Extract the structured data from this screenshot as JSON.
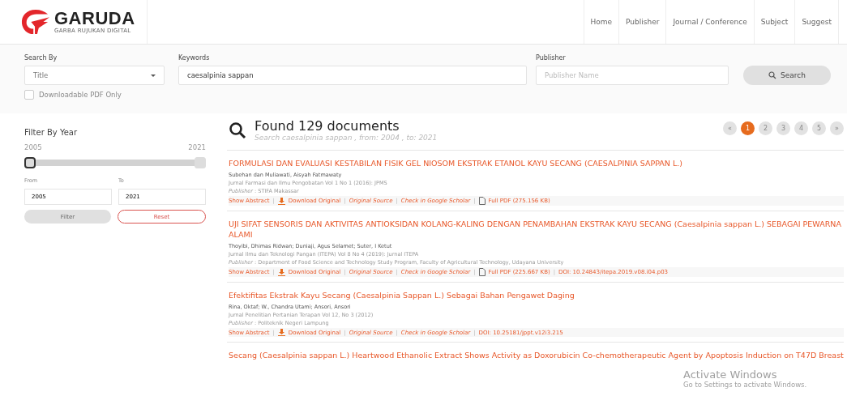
{
  "logo": {
    "name": "GARUDA",
    "tagline": "GARBA RUJUKAN DIGITAL"
  },
  "nav": [
    "Home",
    "Publisher",
    "Journal / Conference",
    "Subject",
    "Suggest"
  ],
  "search": {
    "search_by": {
      "label": "Search By",
      "value": "Title"
    },
    "keywords": {
      "label": "Keywords",
      "value": "caesalpinia sappan"
    },
    "publisher": {
      "label": "Publisher",
      "placeholder": "Publisher Name"
    },
    "button": "Search",
    "pdf_only": {
      "label": "Downloadable PDF Only",
      "checked": false
    }
  },
  "filter": {
    "title": "Filter By Year",
    "min_label": "2005",
    "max_label": "2021",
    "thumbs": [
      {
        "level": 0,
        "selected": true
      },
      {
        "level": 1,
        "selected": false
      }
    ],
    "from": {
      "label": "From",
      "value": "2005"
    },
    "to": {
      "label": "To",
      "value": "2021"
    },
    "filter_button": "Filter",
    "reset_button": "Reset"
  },
  "results": {
    "title": "Found 129 documents",
    "subtitle": "Search *caesalpinia sappan* , from: 2004 , to: 2021",
    "pages": [
      {
        "label": "«",
        "selected": false
      },
      {
        "label": "1",
        "selected": true
      },
      {
        "label": "2",
        "selected": false
      },
      {
        "label": "3",
        "selected": false
      },
      {
        "label": "4",
        "selected": false
      },
      {
        "label": "5",
        "selected": false
      },
      {
        "label": "»",
        "selected": false
      }
    ],
    "items": [
      {
        "title": "FORMULASI DAN EVALUASI KESTABILAN FISIK GEL NIOSOM EKSTRAK ETANOL KAYU SECANG (CAESALPINIA SAPPAN L.)",
        "authors": "Subehan dan Muliawati, Aisyah Fatmawaty",
        "journal": "Jurnal Farmasi dan Ilmu Pengobatan Vol 1 No 1 (2016): JPMS",
        "publisher": "*Publisher* : STIFA Makassar",
        "link_separator": "|",
        "links": [
          {
            "kind": "plain",
            "text": "Show Abstract"
          },
          {
            "kind": "download",
            "text": "Download Original"
          },
          {
            "kind": "italic",
            "text": "Original Source"
          },
          {
            "kind": "italic",
            "text": "Check in Google Scholar"
          },
          {
            "kind": "pdf",
            "text": "Full PDF (275.156 KB)"
          }
        ]
      },
      {
        "title": "UJI SIFAT SENSORIS DAN AKTIVITAS ANTIOKSIDAN KOLANG-KALING DENGAN PENAMBAHAN EKSTRAK KAYU SECANG (Caesalpinia sappan L.) SEBAGAI PEWARNA ALAMI",
        "authors": "Thoyibi, Dhimas Ridwan; Duniaji, Agus Selamet; Suter, I Ketut",
        "journal": "Jurnal Ilmu dan Teknologi Pangan (ITEPA) Vol 8 No 4 (2019): Jurnal ITEPA",
        "publisher": "*Publisher* : Department of Food Science and Technology Study Program, Faculty of Agricultural Technology, Udayana University",
        "link_separator": "|",
        "links": [
          {
            "kind": "plain",
            "text": "Show Abstract"
          },
          {
            "kind": "download",
            "text": "Download Original"
          },
          {
            "kind": "italic",
            "text": "Original Source"
          },
          {
            "kind": "italic",
            "text": "Check in Google Scholar"
          },
          {
            "kind": "pdf",
            "text": "Full PDF (225.667 KB)"
          },
          {
            "kind": "plain",
            "text": "DOI: 10.24843/itepa.2019.v08.i04.p03"
          }
        ]
      },
      {
        "title": "Efektifitas Ekstrak Kayu Secang (Caesalpinia Sappan L.) Sebagai  Bahan Pengawet Daging",
        "authors": "Rina, Oktaf; W., Chandra Utami; Ansori, Ansori",
        "journal": "Jurnal Penelitian Pertanian Terapan  Vol 12, No 3 (2012)",
        "publisher": "*Publisher* : Politeknik Negeri Lampung",
        "link_separator": "|",
        "links": [
          {
            "kind": "plain",
            "text": "Show Abstract"
          },
          {
            "kind": "download",
            "text": "Download Original"
          },
          {
            "kind": "italic",
            "text": "Original Source"
          },
          {
            "kind": "italic",
            "text": "Check in Google Scholar"
          },
          {
            "kind": "plain",
            "text": "DOI: 10.25181/jppt.v12i3.215"
          }
        ]
      },
      {
        "title": "Secang (Caesalpinia sappan L.) Heartwood Ethanolic Extract Shows Activity as Doxorubicin Co-chemotherapeutic Agent by Apoptosis Induction on T47D Breast"
      }
    ]
  },
  "os_notice": {
    "title": "Activate Windows",
    "text": "Go to Settings to activate Windows."
  }
}
